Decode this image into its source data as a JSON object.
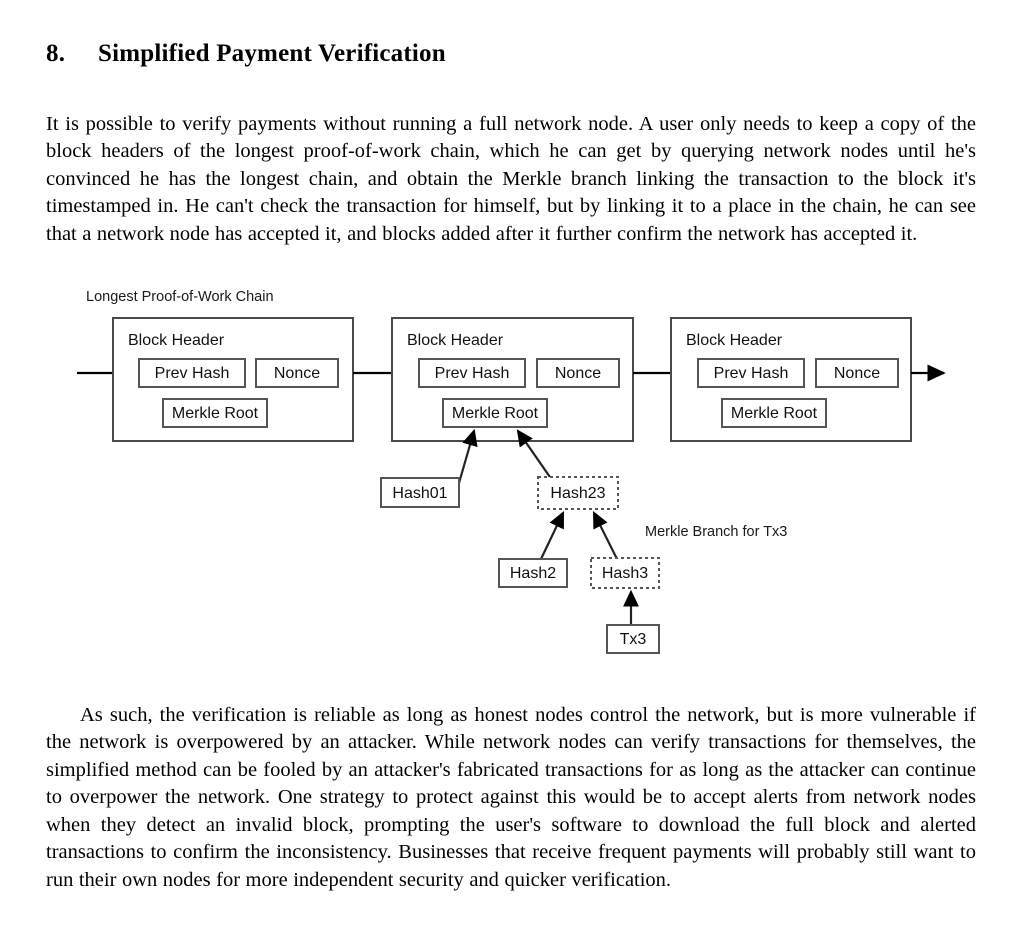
{
  "document": {
    "section_number": "8.",
    "section_title": "Simplified Payment Verification",
    "paragraph_intro": "It is possible to verify payments without running a full network node.  A user only needs to keep a copy of the block headers of the longest proof-of-work chain, which he can get by querying network nodes until he's convinced he has the longest chain, and obtain the Merkle branch linking the transaction to the block it's timestamped in.  He can't check the transaction for himself, but by linking it to a place in the chain, he can see that a network node has accepted it, and blocks added after it further confirm the network has accepted it.",
    "paragraph_outro": "As such, the verification is reliable as long as honest nodes control the network, but is more vulnerable if the network is overpowered by an attacker.  While network nodes can verify transactions for themselves, the simplified method can be fooled by an attacker's fabricated transactions for as long as the attacker can continue to overpower the network.  One strategy to protect against this would be to accept alerts from network nodes when they detect an invalid block, prompting the user's software to download the full block and alerted transactions to confirm the inconsistency.  Businesses that receive frequent payments will probably still want to run their own nodes for more independent security and quicker verification."
  },
  "diagram": {
    "chain_caption": "Longest Proof-of-Work Chain",
    "branch_caption": "Merkle Branch for Tx3",
    "blocks": [
      {
        "header_label": "Block Header",
        "prev_hash_label": "Prev Hash",
        "nonce_label": "Nonce",
        "merkle_root_label": "Merkle Root"
      },
      {
        "header_label": "Block Header",
        "prev_hash_label": "Prev Hash",
        "nonce_label": "Nonce",
        "merkle_root_label": "Merkle Root"
      },
      {
        "header_label": "Block Header",
        "prev_hash_label": "Prev Hash",
        "nonce_label": "Nonce",
        "merkle_root_label": "Merkle Root"
      }
    ],
    "tree_nodes": [
      {
        "label": "Hash01",
        "border": "solid"
      },
      {
        "label": "Hash23",
        "border": "dashed"
      },
      {
        "label": "Hash2",
        "border": "solid"
      },
      {
        "label": "Hash3",
        "border": "dashed"
      },
      {
        "label": "Tx3",
        "border": "solid"
      }
    ],
    "colors": {
      "ink": "#000000",
      "box_stroke": "#555555",
      "outer_stroke": "#4a4a4a",
      "background": "#ffffff"
    }
  }
}
